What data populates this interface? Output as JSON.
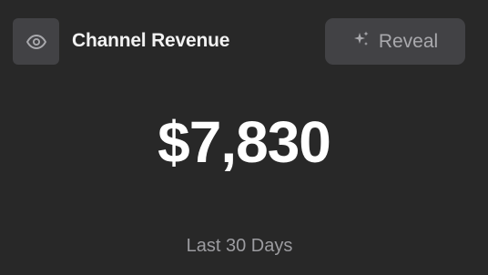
{
  "card": {
    "title": "Channel Revenue",
    "visibility_icon": "eye-icon",
    "reveal_button": {
      "icon": "sparkle-icon",
      "label": "Reveal"
    },
    "amount": "$7,830",
    "period": "Last 30 Days"
  },
  "colors": {
    "background": "#282828",
    "button_background": "#424245",
    "title_text": "#f2f2f2",
    "amount_text": "#ffffff",
    "muted_text": "#9c9ca0"
  }
}
